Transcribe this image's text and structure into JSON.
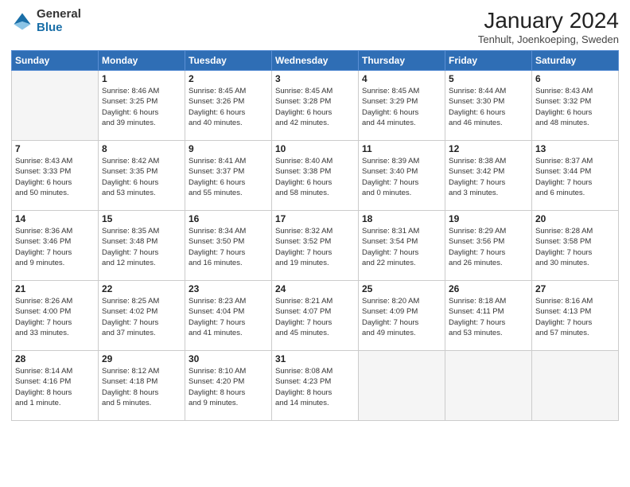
{
  "logo": {
    "general": "General",
    "blue": "Blue"
  },
  "title": "January 2024",
  "location": "Tenhult, Joenkoeping, Sweden",
  "days_header": [
    "Sunday",
    "Monday",
    "Tuesday",
    "Wednesday",
    "Thursday",
    "Friday",
    "Saturday"
  ],
  "weeks": [
    [
      {
        "day": "",
        "info": ""
      },
      {
        "day": "1",
        "info": "Sunrise: 8:46 AM\nSunset: 3:25 PM\nDaylight: 6 hours\nand 39 minutes."
      },
      {
        "day": "2",
        "info": "Sunrise: 8:45 AM\nSunset: 3:26 PM\nDaylight: 6 hours\nand 40 minutes."
      },
      {
        "day": "3",
        "info": "Sunrise: 8:45 AM\nSunset: 3:28 PM\nDaylight: 6 hours\nand 42 minutes."
      },
      {
        "day": "4",
        "info": "Sunrise: 8:45 AM\nSunset: 3:29 PM\nDaylight: 6 hours\nand 44 minutes."
      },
      {
        "day": "5",
        "info": "Sunrise: 8:44 AM\nSunset: 3:30 PM\nDaylight: 6 hours\nand 46 minutes."
      },
      {
        "day": "6",
        "info": "Sunrise: 8:43 AM\nSunset: 3:32 PM\nDaylight: 6 hours\nand 48 minutes."
      }
    ],
    [
      {
        "day": "7",
        "info": "Sunrise: 8:43 AM\nSunset: 3:33 PM\nDaylight: 6 hours\nand 50 minutes."
      },
      {
        "day": "8",
        "info": "Sunrise: 8:42 AM\nSunset: 3:35 PM\nDaylight: 6 hours\nand 53 minutes."
      },
      {
        "day": "9",
        "info": "Sunrise: 8:41 AM\nSunset: 3:37 PM\nDaylight: 6 hours\nand 55 minutes."
      },
      {
        "day": "10",
        "info": "Sunrise: 8:40 AM\nSunset: 3:38 PM\nDaylight: 6 hours\nand 58 minutes."
      },
      {
        "day": "11",
        "info": "Sunrise: 8:39 AM\nSunset: 3:40 PM\nDaylight: 7 hours\nand 0 minutes."
      },
      {
        "day": "12",
        "info": "Sunrise: 8:38 AM\nSunset: 3:42 PM\nDaylight: 7 hours\nand 3 minutes."
      },
      {
        "day": "13",
        "info": "Sunrise: 8:37 AM\nSunset: 3:44 PM\nDaylight: 7 hours\nand 6 minutes."
      }
    ],
    [
      {
        "day": "14",
        "info": "Sunrise: 8:36 AM\nSunset: 3:46 PM\nDaylight: 7 hours\nand 9 minutes."
      },
      {
        "day": "15",
        "info": "Sunrise: 8:35 AM\nSunset: 3:48 PM\nDaylight: 7 hours\nand 12 minutes."
      },
      {
        "day": "16",
        "info": "Sunrise: 8:34 AM\nSunset: 3:50 PM\nDaylight: 7 hours\nand 16 minutes."
      },
      {
        "day": "17",
        "info": "Sunrise: 8:32 AM\nSunset: 3:52 PM\nDaylight: 7 hours\nand 19 minutes."
      },
      {
        "day": "18",
        "info": "Sunrise: 8:31 AM\nSunset: 3:54 PM\nDaylight: 7 hours\nand 22 minutes."
      },
      {
        "day": "19",
        "info": "Sunrise: 8:29 AM\nSunset: 3:56 PM\nDaylight: 7 hours\nand 26 minutes."
      },
      {
        "day": "20",
        "info": "Sunrise: 8:28 AM\nSunset: 3:58 PM\nDaylight: 7 hours\nand 30 minutes."
      }
    ],
    [
      {
        "day": "21",
        "info": "Sunrise: 8:26 AM\nSunset: 4:00 PM\nDaylight: 7 hours\nand 33 minutes."
      },
      {
        "day": "22",
        "info": "Sunrise: 8:25 AM\nSunset: 4:02 PM\nDaylight: 7 hours\nand 37 minutes."
      },
      {
        "day": "23",
        "info": "Sunrise: 8:23 AM\nSunset: 4:04 PM\nDaylight: 7 hours\nand 41 minutes."
      },
      {
        "day": "24",
        "info": "Sunrise: 8:21 AM\nSunset: 4:07 PM\nDaylight: 7 hours\nand 45 minutes."
      },
      {
        "day": "25",
        "info": "Sunrise: 8:20 AM\nSunset: 4:09 PM\nDaylight: 7 hours\nand 49 minutes."
      },
      {
        "day": "26",
        "info": "Sunrise: 8:18 AM\nSunset: 4:11 PM\nDaylight: 7 hours\nand 53 minutes."
      },
      {
        "day": "27",
        "info": "Sunrise: 8:16 AM\nSunset: 4:13 PM\nDaylight: 7 hours\nand 57 minutes."
      }
    ],
    [
      {
        "day": "28",
        "info": "Sunrise: 8:14 AM\nSunset: 4:16 PM\nDaylight: 8 hours\nand 1 minute."
      },
      {
        "day": "29",
        "info": "Sunrise: 8:12 AM\nSunset: 4:18 PM\nDaylight: 8 hours\nand 5 minutes."
      },
      {
        "day": "30",
        "info": "Sunrise: 8:10 AM\nSunset: 4:20 PM\nDaylight: 8 hours\nand 9 minutes."
      },
      {
        "day": "31",
        "info": "Sunrise: 8:08 AM\nSunset: 4:23 PM\nDaylight: 8 hours\nand 14 minutes."
      },
      {
        "day": "",
        "info": ""
      },
      {
        "day": "",
        "info": ""
      },
      {
        "day": "",
        "info": ""
      }
    ]
  ]
}
